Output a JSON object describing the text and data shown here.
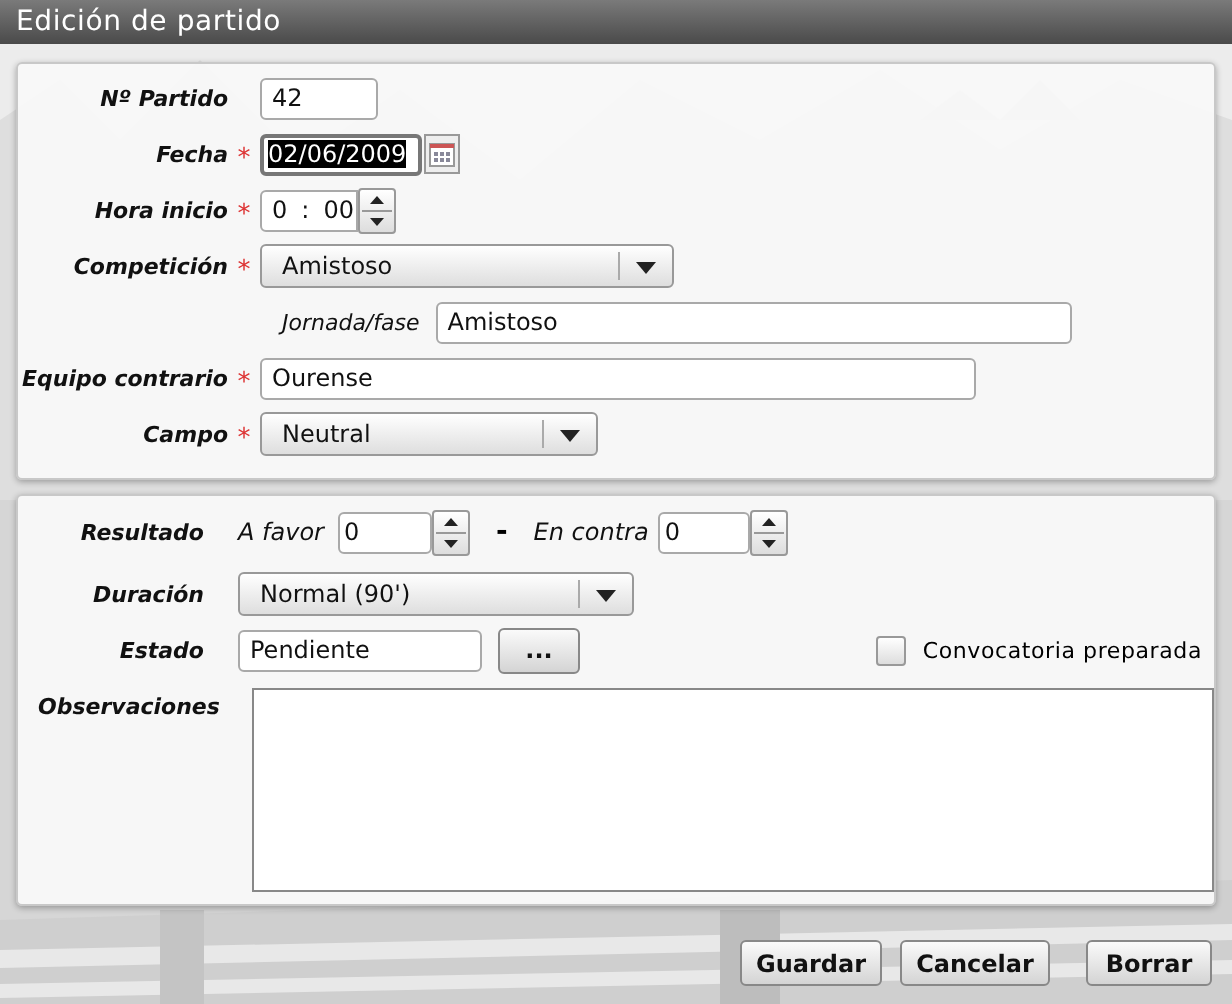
{
  "title": "Edición de partido",
  "required_mark": "*",
  "match_panel": {
    "fields": [
      {
        "kind": "text",
        "label": "Nº Partido",
        "required": false,
        "value": "42"
      },
      {
        "kind": "date",
        "label": "Fecha",
        "required": true,
        "value": "02/06/2009",
        "text_selected": true
      },
      {
        "kind": "time",
        "label": "Hora inicio",
        "required": true,
        "hours": "0",
        "separator": ":",
        "minutes": "00"
      },
      {
        "kind": "select",
        "label": "Competición",
        "required": true,
        "value": "Amistoso"
      },
      {
        "kind": "subtext",
        "label": "Jornada/fase",
        "value": "Amistoso"
      },
      {
        "kind": "text",
        "label": "Equipo contrario",
        "required": true,
        "value": "Ourense"
      },
      {
        "kind": "select",
        "label": "Campo",
        "required": true,
        "value": "Neutral"
      }
    ]
  },
  "result_panel": {
    "result": {
      "label": "Resultado",
      "for_label": "A favor",
      "for_value": "0",
      "dash": "-",
      "against_label": "En contra",
      "against_value": "0"
    },
    "duration": {
      "label": "Duración",
      "value": "Normal (90')"
    },
    "status": {
      "label": "Estado",
      "value": "Pendiente",
      "button": "..."
    },
    "call_up": {
      "label": "Convocatoria preparada",
      "checked": false
    },
    "notes": {
      "label": "Observaciones"
    }
  },
  "buttons": [
    "Guardar",
    "Cancelar",
    "Borrar"
  ]
}
